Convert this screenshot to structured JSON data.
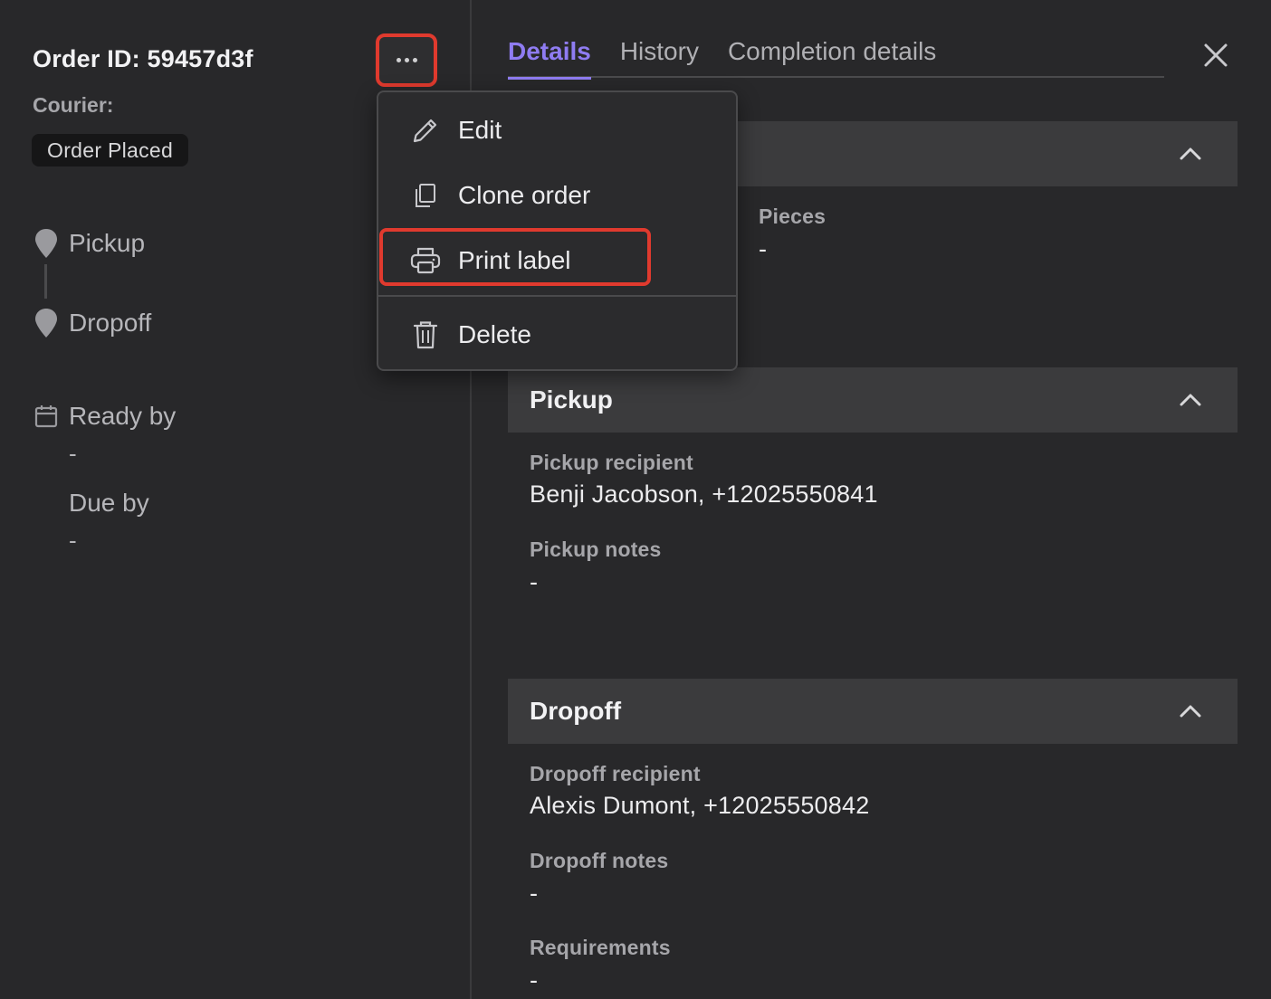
{
  "order": {
    "id_label": "Order ID: 59457d3f",
    "courier_label": "Courier:",
    "status": "Order Placed"
  },
  "route": {
    "pickup_label": "Pickup",
    "dropoff_label": "Dropoff"
  },
  "times": {
    "ready_by_label": "Ready by",
    "ready_by_value": "-",
    "due_by_label": "Due by",
    "due_by_value": "-"
  },
  "tabs": [
    {
      "label": "Details",
      "active": true
    },
    {
      "label": "History",
      "active": false
    },
    {
      "label": "Completion details",
      "active": false
    }
  ],
  "menu": {
    "items": [
      {
        "label": "Edit",
        "icon": "pencil-icon"
      },
      {
        "label": "Clone order",
        "icon": "copy-icon"
      },
      {
        "label": "Print label",
        "icon": "printer-icon"
      },
      {
        "label": "Delete",
        "icon": "trash-icon"
      }
    ]
  },
  "sections": {
    "top": {
      "pieces_label": "Pieces",
      "pieces_value": "-"
    },
    "pickup": {
      "title": "Pickup",
      "recipient_label": "Pickup recipient",
      "recipient_value": "Benji Jacobson, +12025550841",
      "notes_label": "Pickup notes",
      "notes_value": "-"
    },
    "dropoff": {
      "title": "Dropoff",
      "recipient_label": "Dropoff recipient",
      "recipient_value": "Alexis Dumont, +12025550842",
      "notes_label": "Dropoff notes",
      "notes_value": "-",
      "requirements_label": "Requirements",
      "requirements_value": "-"
    }
  },
  "colors": {
    "accent": "#8f7cf2",
    "highlight": "#e03a2e",
    "background": "#28282a",
    "section_header": "#3b3b3d"
  }
}
